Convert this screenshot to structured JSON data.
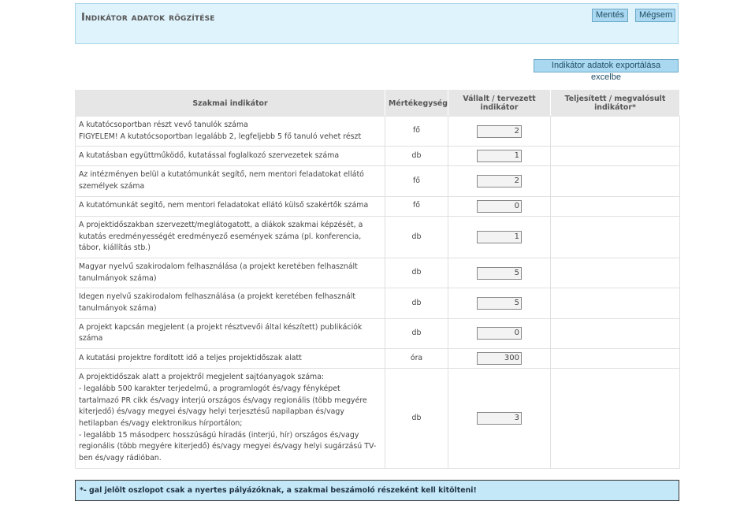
{
  "header": {
    "title": "Indikátor adatok rögzítése",
    "save_label": "Mentés",
    "cancel_label": "Mégsem"
  },
  "toolbar": {
    "export_label": "Indikátor adatok exportálása excelbe"
  },
  "table": {
    "columns": [
      "Szakmai indikátor",
      "Mértékegység",
      "Vállalt / tervezett indikátor",
      "Teljesített / megvalósult indikátor*"
    ],
    "rows": [
      {
        "text_lines": [
          "A kutatócsoportban részt vevő tanulók száma",
          "FIGYELEM! A kutatócsoportban legalább 2, legfeljebb 5 fő tanuló vehet részt"
        ],
        "unit": "fő",
        "value": "2",
        "actual": ""
      },
      {
        "text_lines": [
          "A kutatásban együttműködő, kutatással foglalkozó szervezetek száma"
        ],
        "unit": "db",
        "value": "1",
        "actual": ""
      },
      {
        "text_lines": [
          "Az intézményen belül a kutatómunkát segítő, nem mentori feladatokat ellátó személyek száma"
        ],
        "unit": "fő",
        "value": "2",
        "actual": ""
      },
      {
        "text_lines": [
          "A kutatómunkát segítő, nem mentori feladatokat ellátó külső szakértők száma"
        ],
        "unit": "fő",
        "value": "0",
        "actual": ""
      },
      {
        "text_lines": [
          "A projektidőszakban szervezett/meglátogatott, a diákok szakmai képzését, a kutatás eredményességét eredményező események száma (pl. konferencia, tábor, kiállítás stb.)"
        ],
        "unit": "db",
        "value": "1",
        "actual": ""
      },
      {
        "text_lines": [
          "Magyar nyelvű szakirodalom felhasználása (a projekt keretében felhasznált tanulmányok száma)"
        ],
        "unit": "db",
        "value": "5",
        "actual": ""
      },
      {
        "text_lines": [
          "Idegen nyelvű szakirodalom felhasználása (a projekt keretében felhasznált tanulmányok száma)"
        ],
        "unit": "db",
        "value": "5",
        "actual": ""
      },
      {
        "text_lines": [
          "A projekt kapcsán megjelent (a projekt résztvevői által készített) publikációk száma"
        ],
        "unit": "db",
        "value": "0",
        "actual": ""
      },
      {
        "text_lines": [
          "A kutatási projektre fordított idő a teljes projektidőszak alatt"
        ],
        "unit": "óra",
        "value": "300",
        "actual": ""
      },
      {
        "text_lines": [
          "A projektidőszak alatt a projektről megjelent sajtóanyagok száma:",
          "- legalább 500 karakter terjedelmű, a programlogót és/vagy fényképet tartalmazó PR cikk és/vagy interjú országos és/vagy regionális (több megyére kiterjedő) és/vagy megyei és/vagy helyi terjesztésű napilapban és/vagy hetilapban és/vagy elektronikus hírportálon;",
          "- legalább 15 másodperc hosszúságú híradás (interjú, hír) országos és/vagy regionális (több megyére kiterjedő) és/vagy megyei és/vagy helyi sugárzású TV-ben és/vagy rádióban."
        ],
        "unit": "db",
        "value": "3",
        "actual": ""
      }
    ]
  },
  "footnote": "*- gal jelölt oszlopot csak a nyertes pályázóknak, a szakmai beszámoló részeként kell kitölteni!"
}
